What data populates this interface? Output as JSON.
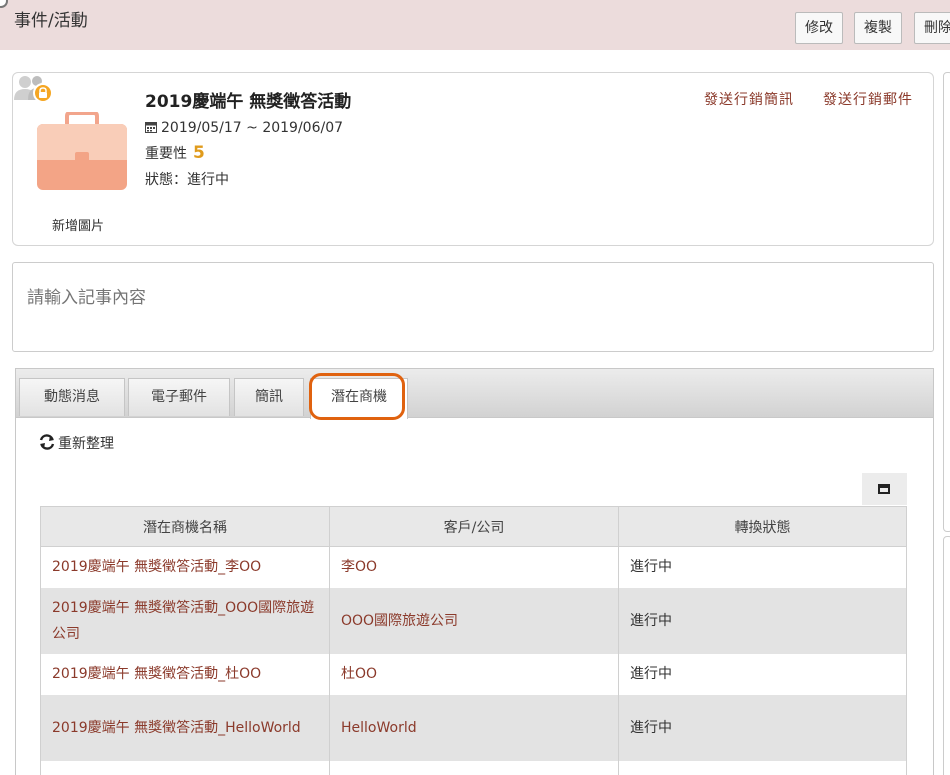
{
  "header": {
    "title": "事件/活動",
    "buttons": {
      "edit": "修改",
      "copy": "複製",
      "delete": "刪除"
    }
  },
  "event": {
    "title": "2019慶端午 無獎徵答活動",
    "date_range": "2019/05/17 ~ 2019/06/07",
    "importance_label": "重要性",
    "importance_value": "5",
    "status_line": "狀態：進行中",
    "add_photo": "新增圖片",
    "links": {
      "send_sms": "發送行銷簡訊",
      "send_email": "發送行銷郵件"
    }
  },
  "note": {
    "placeholder": "請輸入記事內容"
  },
  "tabs": [
    {
      "label": "動態消息"
    },
    {
      "label": "電子郵件"
    },
    {
      "label": "簡訊"
    },
    {
      "label": "潛在商機",
      "active": true
    }
  ],
  "reload_label": "重新整理",
  "table": {
    "columns": [
      "潛在商機名稱",
      "客戶/公司",
      "轉換狀態"
    ],
    "rows": [
      {
        "name": "2019慶端午 無獎徵答活動_李OO",
        "customer": "李OO",
        "status": "進行中"
      },
      {
        "name": "2019慶端午 無獎徵答活動_OOO國際旅遊公司",
        "customer": "OOO國際旅遊公司",
        "status": "進行中"
      },
      {
        "name": "2019慶端午 無獎徵答活動_杜OO",
        "customer": "杜OO",
        "status": "進行中"
      },
      {
        "name": "2019慶端午 無獎徵答活動_HelloWorld",
        "customer": "HelloWorld",
        "status": "進行中"
      }
    ]
  },
  "colors": {
    "header_bg": "#ecdcdc",
    "link": "#8b3a2b",
    "importance": "#e09b1c",
    "highlight": "#e0620f"
  }
}
